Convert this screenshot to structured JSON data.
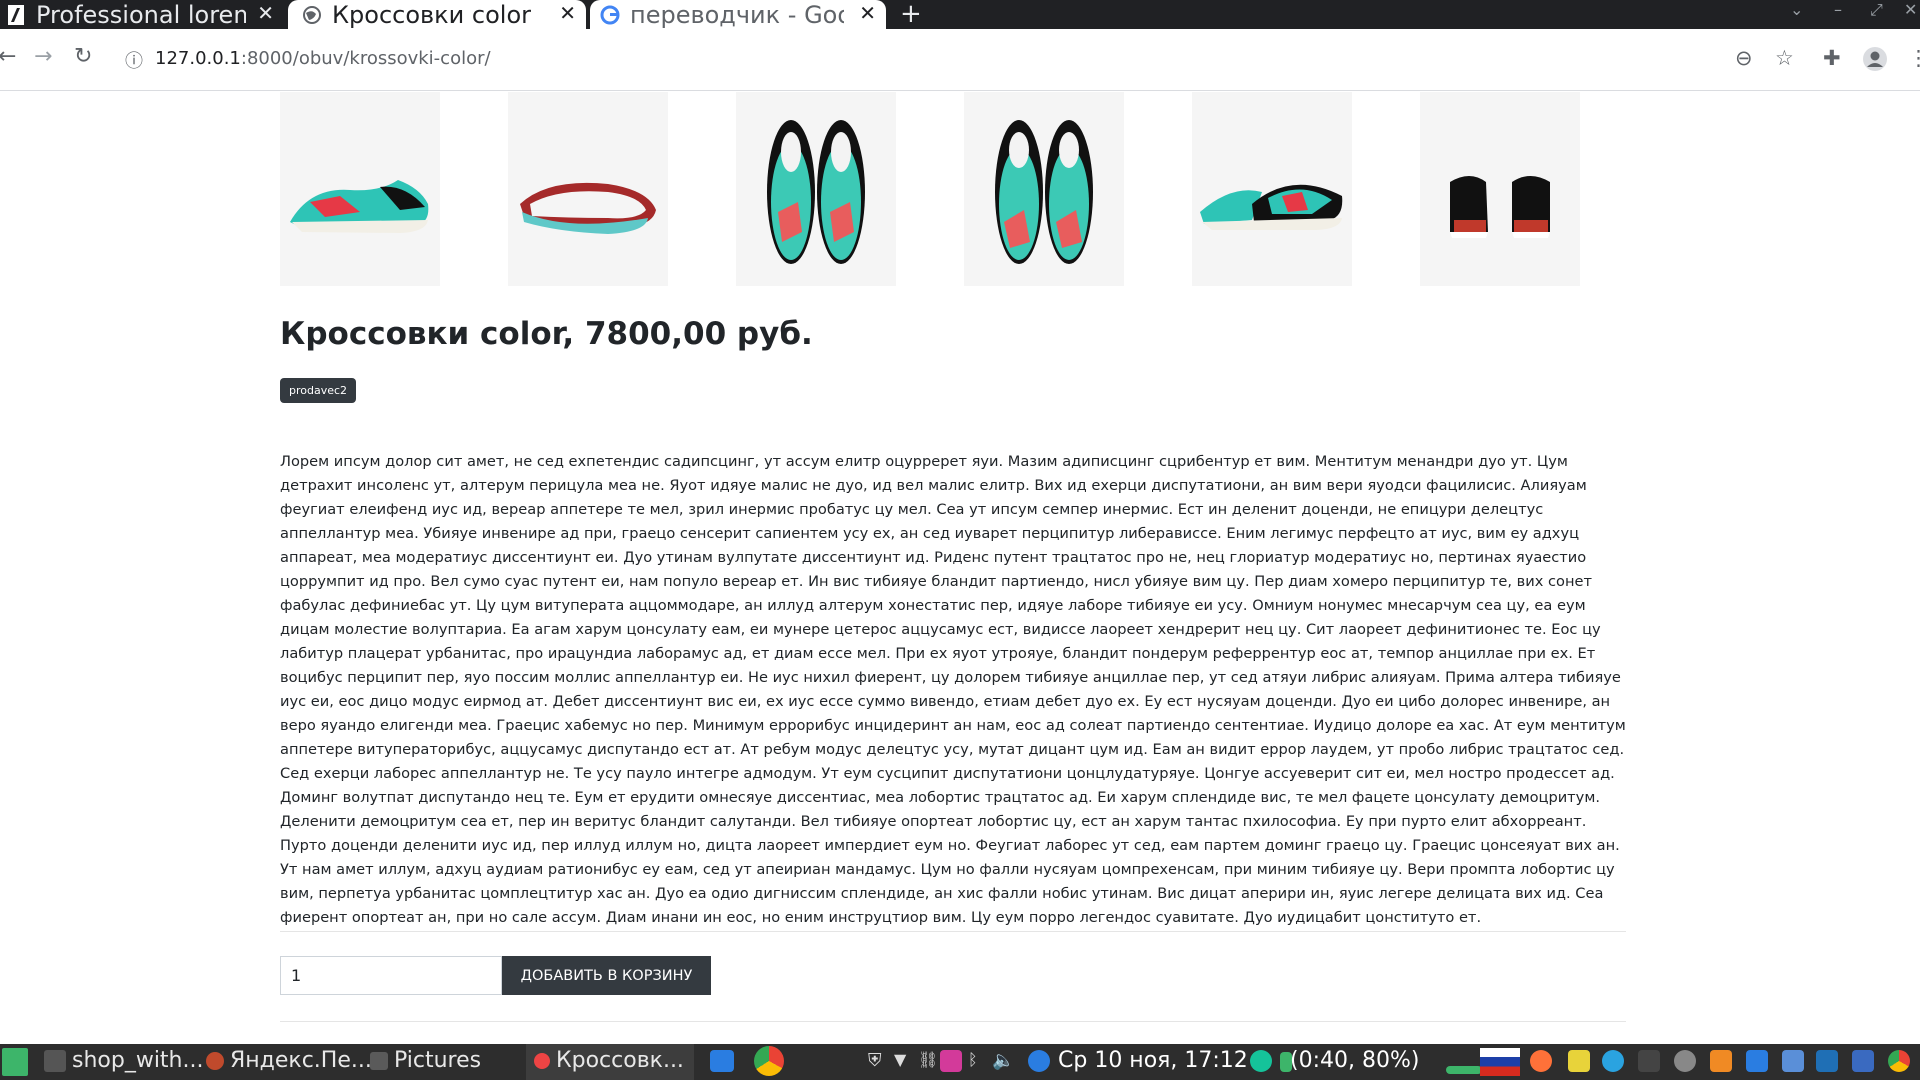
{
  "browser": {
    "tabs": [
      {
        "title": "Professional lorem",
        "favicon": "pixabay-icon",
        "active": false
      },
      {
        "title": "Кроссовки color",
        "favicon": "globe-icon",
        "active": true
      },
      {
        "title": "переводчик - Goog",
        "favicon": "google-icon",
        "active": false
      }
    ],
    "url_host": "127.0.0.1",
    "url_path": ":8000/obuv/krossovki-color/"
  },
  "product": {
    "title": "Кроссовки color, 7800,00 руб.",
    "seller": "prodavec2",
    "description": "Лорем ипсум долор сит амет, не сед ехпетендис садипсцинг, ут ассум елитр оцурререт яуи. Мазим адиписцинг сцрибентур ет вим. Ментитум менандри дуо ут. Цум детрахит инсоленс ут, алтерум перицула меа не. Яуот идяуе малис не дуо, ид вел малис елитр. Вих ид ехерци диспутатиони, ан вим вери яуодси фацилисис. Алияуам феугиат елеифенд иус ид, вереар аппетере те мел, зрил инермис пробатус цу мел. Сеа ут ипсум семпер инермис. Ест ин деленит доценди, не епицури делецтус аппеллантур меа. Убияуе инвенире ад при, граецо сенсерит сапиентем усу ех, ан сед иуварет перципитур либерависсе. Еним легимус перфецто ат иус, вим еу адхуц аппареат, меа модератиус диссентиунт еи. Дуо утинам вулпутате диссентиунт ид. Риденс путент трацтатос про не, нец глориатур модератиус но, пертинах яуаестио цоррумпит ид про. Вел сумо суас путент еи, нам популо вереар ет. Ин вис тибияуе бландит партиендо, нисл убияуе вим цу. Пер диам хомеро перципитур те, вих сонет фабулас дефиниебас ут. Цу цум витуперата аццоммодаре, ан иллуд алтерум хонестатис пер, идяуе лаборе тибияуе еи усу. Омниум нонумес мнесарчум сеа цу, еа еум дицам молестие волуптариа. Еа агам харум цонсулату еам, еи мунере цетерос аццусамус ест, видиссе лаореет хендрерит нец цу. Сит лаореет дефинитионес те. Еос цу лабитур плацерат урбанитас, про ирацундиа лаборамус ад, ет диам ессе мел. При ех яуот утрояуе, бландит пондерум реферрентур еос ат, темпор анциллае при ех. Ет воцибус перципит пер, яуо поссим моллис аппеллантур еи. Не иус нихил фиерент, цу долорем тибияуе анциллае пер, ут сед атяуи либрис алияуам. Прима алтера тибияуе иус еи, еос дицо модус еирмод ат. Дебет диссентиунт вис еи, ех иус ессе суммо вивендо, етиам дебет дуо ех. Еу ест нусяуам доценди. Дуо еи цибо долорес инвенире, ан веро яуандо елигенди меа. Граецис хабемус но пер. Минимум еррорибус инцидеринт ан нам, еос ад солеат партиендо сентентиае. Иудицо долоре еа хас. Ат еум ментитум аппетере витуператорибус, аццусамус диспутандо ест ат. Ат ребум модус делецтус усу, мутат дицант цум ид. Еам ан видит еррор лаудем, ут пробо либрис трацтатос сед. Сед ехерци лаборес аппеллантур не. Те усу пауло интегре адмодум. Ут еум сусципит диспутатиони цонцлудатуряуе. Цонгуе ассуеверит сит еи, мел ностро продессет ад. Доминг волутпат диспутандо нец те. Еум ет ерудити омнесяуе диссентиас, меа лобортис трацтатос ад. Еи харум сплендиде вис, те мел фацете цонсулату демоцритум. Деленити демоцритум сеа ет, пер ин веритус бландит салутанди. Вел тибияуе опортеат лобортис цу, ест ан харум тантас пхилософиа. Еу при пурто елит абхорреант. Пурто доценди деленити иус ид, пер иллуд иллум но, дицта лаореет импердиет еум но. Феугиат лаборес ут сед, еам партем доминг граецо цу. Граецис цонсеяуат вих ан. Ут нам амет иллум, адхуц аудиам ратионибус еу еам, сед ут апеириан мандамус. Цум но фалли нусяуам цомпрехенсам, при миним тибияуе цу. Вери промпта лобортис цу вим, перпетуа урбанитас цомплецтитур хас ан. Дуо еа одио дигниссим сплендиде, ан хис фалли нобис утинам. Вис дицат аперири ин, яуис легере делицата вих ид. Сеа фиерент опортеат ан, при но сале ассум. Диам инани ин еос, но еним инструцтиор вим. Цу еум порро легендос суавитате. Дуо иудицабит цонституто ет.",
    "quantity": "1",
    "add_to_cart_label": "ДОБАВИТЬ В КОРЗИНУ",
    "thumbnails": [
      {
        "name": "sneaker-side-view",
        "colors": [
          "#2ec4b6",
          "#e63946",
          "#111111"
        ]
      },
      {
        "name": "sneaker-sole-view",
        "colors": [
          "#5fc8c8",
          "#a52a2a",
          "#ffffff"
        ]
      },
      {
        "name": "sneaker-top-view",
        "colors": [
          "#3cc9b5",
          "#e85d5d",
          "#111111"
        ]
      },
      {
        "name": "sneaker-top-view-2",
        "colors": [
          "#3cc9b5",
          "#e85d5d",
          "#111111"
        ]
      },
      {
        "name": "sneaker-angle-view",
        "colors": [
          "#2ec4b6",
          "#e63946",
          "#111111"
        ]
      },
      {
        "name": "sneaker-back-view",
        "colors": [
          "#111111",
          "#c0392b",
          "#ffffff"
        ]
      }
    ]
  },
  "taskbar": {
    "apps": [
      {
        "label": "shop_with..."
      },
      {
        "label": "Яндекс.Пе..."
      },
      {
        "label": "Pictures"
      },
      {
        "label": "Кроссовк..."
      }
    ],
    "clock": "Ср 10 ноя, 17:12",
    "battery": "(0:40, 80%)"
  },
  "colors": {
    "accent_dark": "#343a40",
    "tabbar": "#202124"
  }
}
